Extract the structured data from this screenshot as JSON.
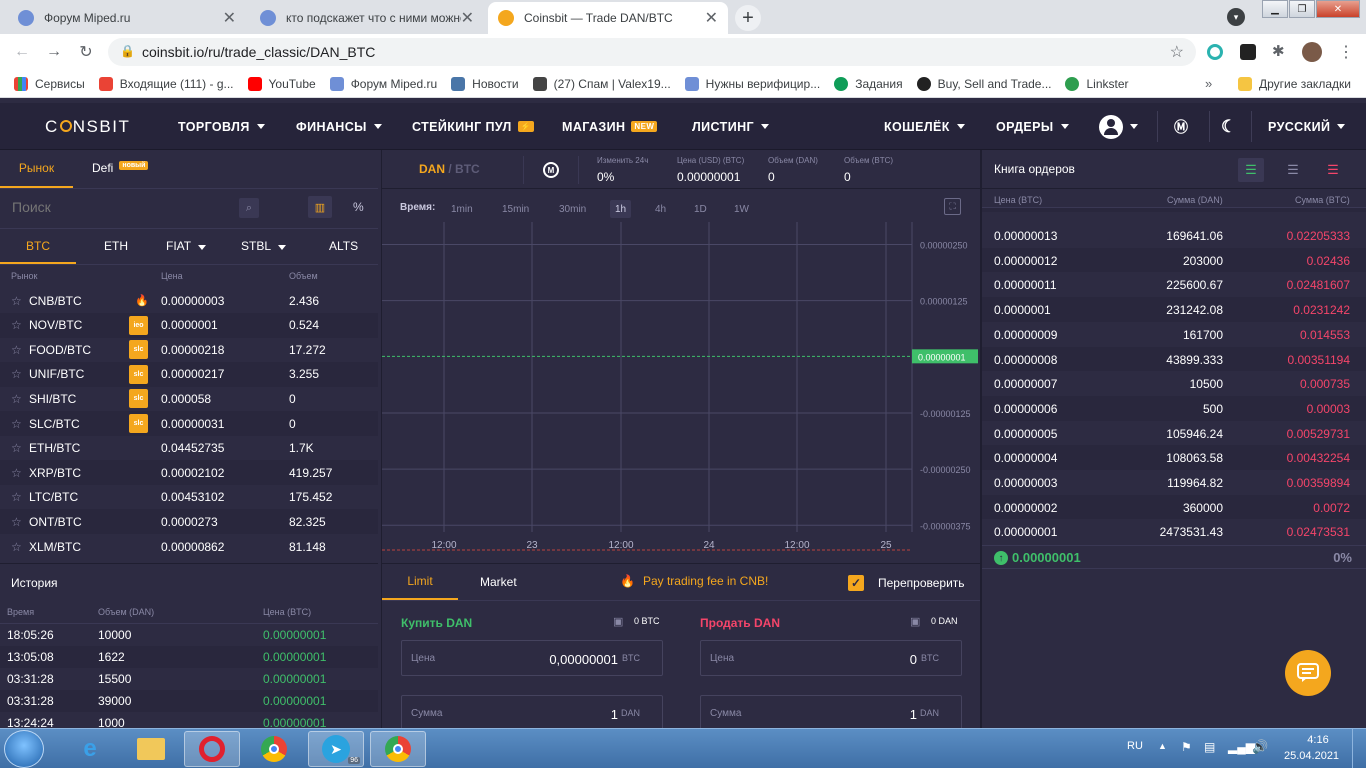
{
  "browser": {
    "tabs": [
      {
        "title": "Форум Miped.ru",
        "icon": "miped-favicon"
      },
      {
        "title": "кто подскажет что с ними можно",
        "icon": "miped-favicon"
      },
      {
        "title": "Coinsbit — Trade DAN/BTC",
        "icon": "coinsbit-favicon"
      }
    ],
    "url": "coinsbit.io/ru/trade_classic/DAN_BTC",
    "bookmarks": [
      "Сервисы",
      "Входящие (111) - g...",
      "YouTube",
      "Форум Miped.ru",
      "Новости",
      "(27) Спам | Valex19...",
      "Нужны верифицир...",
      "Задания",
      "Buy, Sell and Trade...",
      "Linkster"
    ],
    "other_bookmarks": "Другие закладки"
  },
  "header": {
    "logo_pre": "C",
    "logo_post": "NSBIT",
    "nav": [
      "ТОРГОВЛЯ",
      "ФИНАНСЫ",
      "СТЕЙКИНГ ПУЛ",
      "МАГАЗИН",
      "ЛИСТИНГ"
    ],
    "shop_badge": "NEW",
    "wallet": "КОШЕЛЁК",
    "orders": "ОРДЕРЫ",
    "language": "РУССКИЙ"
  },
  "market": {
    "tab_market": "Рынок",
    "tab_defi": "Defi",
    "defi_badge": "новый",
    "search_placeholder": "Поиск",
    "percent": "%",
    "quote_tabs": [
      "BTC",
      "ETH",
      "FIAT",
      "STBL",
      "ALTS"
    ],
    "columns": [
      "Рынок",
      "Цена",
      "Объем"
    ],
    "rows": [
      {
        "pair": "CNB/BTC",
        "tag": "fire",
        "price": "0.00000003",
        "volume": "2.436"
      },
      {
        "pair": "NOV/BTC",
        "tag": "ieo",
        "price": "0.0000001",
        "volume": "0.524"
      },
      {
        "pair": "FOOD/BTC",
        "tag": "slc",
        "price": "0.00000218",
        "volume": "17.272"
      },
      {
        "pair": "UNIF/BTC",
        "tag": "slc",
        "price": "0.00000217",
        "volume": "3.255"
      },
      {
        "pair": "SHI/BTC",
        "tag": "slc",
        "price": "0.000058",
        "volume": "0"
      },
      {
        "pair": "SLC/BTC",
        "tag": "slc",
        "price": "0.00000031",
        "volume": "0"
      },
      {
        "pair": "ETH/BTC",
        "tag": "",
        "price": "0.04452735",
        "volume": "1.7K"
      },
      {
        "pair": "XRP/BTC",
        "tag": "",
        "price": "0.00002102",
        "volume": "419.257"
      },
      {
        "pair": "LTC/BTC",
        "tag": "",
        "price": "0.00453102",
        "volume": "175.452"
      },
      {
        "pair": "ONT/BTC",
        "tag": "",
        "price": "0.0000273",
        "volume": "82.325"
      },
      {
        "pair": "XLM/BTC",
        "tag": "",
        "price": "0.00000862",
        "volume": "81.148"
      }
    ]
  },
  "history": {
    "title": "История",
    "columns": [
      "Время",
      "Объем (DAN)",
      "Цена (BTC)"
    ],
    "rows": [
      {
        "time": "18:05:26",
        "volume": "10000",
        "price": "0.00000001"
      },
      {
        "time": "13:05:08",
        "volume": "1622",
        "price": "0.00000001"
      },
      {
        "time": "03:31:28",
        "volume": "15500",
        "price": "0.00000001"
      },
      {
        "time": "03:31:28",
        "volume": "39000",
        "price": "0.00000001"
      },
      {
        "time": "13:24:24",
        "volume": "1000",
        "price": "0.00000001"
      }
    ]
  },
  "ticker": {
    "base": "DAN",
    "quote": "BTC",
    "stats": [
      {
        "label": "Изменить 24ч",
        "value": "0%"
      },
      {
        "label": "Цена (USD) (BTC)",
        "value": "0.00000001"
      },
      {
        "label": "Объем (DAN)",
        "value": "0"
      },
      {
        "label": "Объем (BTC)",
        "value": "0"
      }
    ]
  },
  "chart": {
    "time_label": "Время:",
    "timeframes": [
      "1min",
      "15min",
      "30min",
      "1h",
      "4h",
      "1D",
      "1W"
    ],
    "selected_timeframe": "1h",
    "y_ticks": [
      "0.00000250",
      "0.00000125",
      "-0.00000125",
      "-0.00000250",
      "-0.00000375"
    ],
    "current_price": "0.00000001",
    "x_ticks": [
      "12:00",
      "23",
      "12:00",
      "24",
      "12:00",
      "25"
    ]
  },
  "chart_data": {
    "type": "line",
    "x": [
      "12:00",
      "23",
      "12:00",
      "24",
      "12:00",
      "25"
    ],
    "series": [
      {
        "values": [
          1e-08,
          1e-08,
          1e-08,
          1e-08,
          1e-08,
          1e-08
        ]
      }
    ],
    "ylim": [
      -3.75e-06,
      2.5e-06
    ],
    "grid": true
  },
  "trade": {
    "tabs": [
      "Limit",
      "Market"
    ],
    "promo": "Pay trading fee in CNB!",
    "recheck": "Перепроверить",
    "buy": {
      "title": "Купить DAN",
      "balance": "0 BTC",
      "price_label": "Цена",
      "price": "0,00000001",
      "price_unit": "BTC",
      "amount_label": "Сумма",
      "amount": "1",
      "amount_unit": "DAN"
    },
    "sell": {
      "title": "Продать DAN",
      "balance": "0 DAN",
      "price_label": "Цена",
      "price": "0",
      "price_unit": "BTC",
      "amount_label": "Сумма",
      "amount": "1",
      "amount_unit": "DAN"
    }
  },
  "orderbook": {
    "title": "Книга ордеров",
    "columns": [
      "Цена (BTC)",
      "Сумма (DAN)",
      "Сумма (BTC)"
    ],
    "rows": [
      {
        "price": "0.00000013",
        "amount": "169641.06",
        "total": "0.02205333"
      },
      {
        "price": "0.00000012",
        "amount": "203000",
        "total": "0.02436"
      },
      {
        "price": "0.00000011",
        "amount": "225600.67",
        "total": "0.02481607"
      },
      {
        "price": "0.0000001",
        "amount": "231242.08",
        "total": "0.0231242"
      },
      {
        "price": "0.00000009",
        "amount": "161700",
        "total": "0.014553"
      },
      {
        "price": "0.00000008",
        "amount": "43899.333",
        "total": "0.00351194"
      },
      {
        "price": "0.00000007",
        "amount": "10500",
        "total": "0.000735"
      },
      {
        "price": "0.00000006",
        "amount": "500",
        "total": "0.00003"
      },
      {
        "price": "0.00000005",
        "amount": "105946.24",
        "total": "0.00529731"
      },
      {
        "price": "0.00000004",
        "amount": "108063.58",
        "total": "0.00432254"
      },
      {
        "price": "0.00000003",
        "amount": "119964.82",
        "total": "0.00359894"
      },
      {
        "price": "0.00000002",
        "amount": "360000",
        "total": "0.0072"
      },
      {
        "price": "0.00000001",
        "amount": "2473531.43",
        "total": "0.02473531"
      }
    ],
    "last_price": "0.00000001",
    "last_change": "0%"
  },
  "taskbar": {
    "lang": "RU",
    "time": "4:16",
    "date": "25.04.2021",
    "telegram_badge": "96"
  },
  "colors": {
    "accent": "#f4a71e",
    "buy": "#3fbf6a",
    "sell": "#f5456a",
    "bg": "#2d2b42"
  }
}
